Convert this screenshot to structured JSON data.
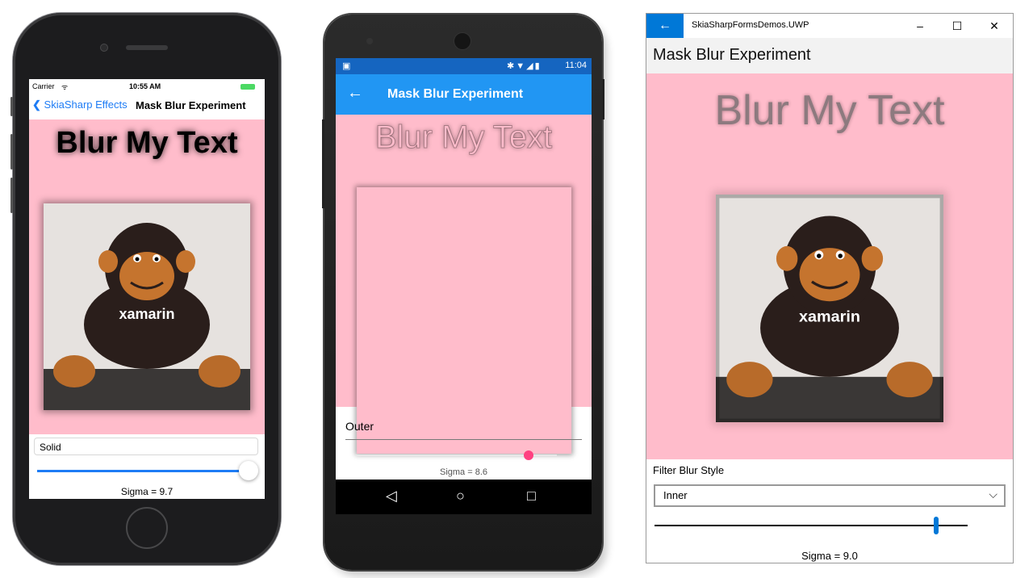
{
  "ios": {
    "status": {
      "carrier": "Carrier",
      "time": "10:55 AM"
    },
    "nav": {
      "back_label": "SkiaSharp Effects",
      "title": "Mask Blur Experiment"
    },
    "canvas": {
      "text": "Blur My Text",
      "background": "#ffbccb"
    },
    "picker": {
      "value": "Solid"
    },
    "slider": {
      "fraction": 0.97
    },
    "sigma_label": "Sigma = 9.7"
  },
  "android": {
    "status": {
      "time": "11:04"
    },
    "appbar": {
      "title": "Mask Blur Experiment"
    },
    "canvas": {
      "text": "Blur My Text",
      "background": "#ffbccb"
    },
    "picker": {
      "value": "Outer"
    },
    "slider": {
      "fraction": 0.86
    },
    "sigma_label": "Sigma = 8.6"
  },
  "uwp": {
    "app_title": "SkiaSharpFormsDemos.UWP",
    "page_title": "Mask Blur Experiment",
    "canvas": {
      "text": "Blur My Text",
      "background": "#ffbccb"
    },
    "picker": {
      "label": "Filter Blur Style",
      "value": "Inner"
    },
    "slider": {
      "fraction": 0.9
    },
    "sigma_label": "Sigma = 9.0",
    "accent": "#0078d7"
  },
  "icons": {
    "back": "back-arrow-icon",
    "android_nav": [
      "nav-back-icon",
      "nav-home-icon",
      "nav-recents-icon"
    ],
    "window_controls": [
      "minimize-icon",
      "maximize-icon",
      "close-icon"
    ]
  }
}
